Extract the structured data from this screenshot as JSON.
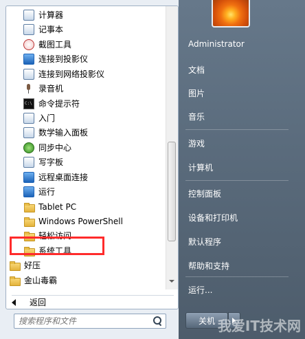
{
  "left_menu": {
    "items": [
      {
        "label": "计算器",
        "icon": "calculator-icon"
      },
      {
        "label": "记事本",
        "icon": "notepad-icon"
      },
      {
        "label": "截图工具",
        "icon": "snipping-tool-icon"
      },
      {
        "label": "连接到投影仪",
        "icon": "projector-icon"
      },
      {
        "label": "连接到网络投影仪",
        "icon": "network-projector-icon"
      },
      {
        "label": "录音机",
        "icon": "microphone-icon"
      },
      {
        "label": "命令提示符",
        "icon": "cmd-icon"
      },
      {
        "label": "入门",
        "icon": "getting-started-icon"
      },
      {
        "label": "数学输入面板",
        "icon": "math-input-icon"
      },
      {
        "label": "同步中心",
        "icon": "sync-center-icon"
      },
      {
        "label": "写字板",
        "icon": "wordpad-icon"
      },
      {
        "label": "远程桌面连接",
        "icon": "remote-desktop-icon"
      },
      {
        "label": "运行",
        "icon": "run-icon"
      },
      {
        "label": "Tablet PC",
        "icon": "folder-icon"
      },
      {
        "label": "Windows PowerShell",
        "icon": "folder-icon"
      },
      {
        "label": "轻松访问",
        "icon": "folder-icon"
      },
      {
        "label": "系统工具",
        "icon": "folder-icon"
      },
      {
        "label": "好压",
        "icon": "folder-icon"
      },
      {
        "label": "金山毒霸",
        "icon": "folder-icon"
      }
    ],
    "back_label": "返回",
    "search_placeholder": "搜索程序和文件"
  },
  "right_menu": {
    "items": [
      {
        "label": "Administrator"
      },
      {
        "label": "文档"
      },
      {
        "label": "图片"
      },
      {
        "label": "音乐"
      },
      {
        "label": "游戏"
      },
      {
        "label": "计算机"
      },
      {
        "label": "控制面板"
      },
      {
        "label": "设备和打印机"
      },
      {
        "label": "默认程序"
      },
      {
        "label": "帮助和支持"
      },
      {
        "label": "运行..."
      }
    ],
    "shutdown_label": "关机"
  },
  "watermark": "我爱IT技术网"
}
